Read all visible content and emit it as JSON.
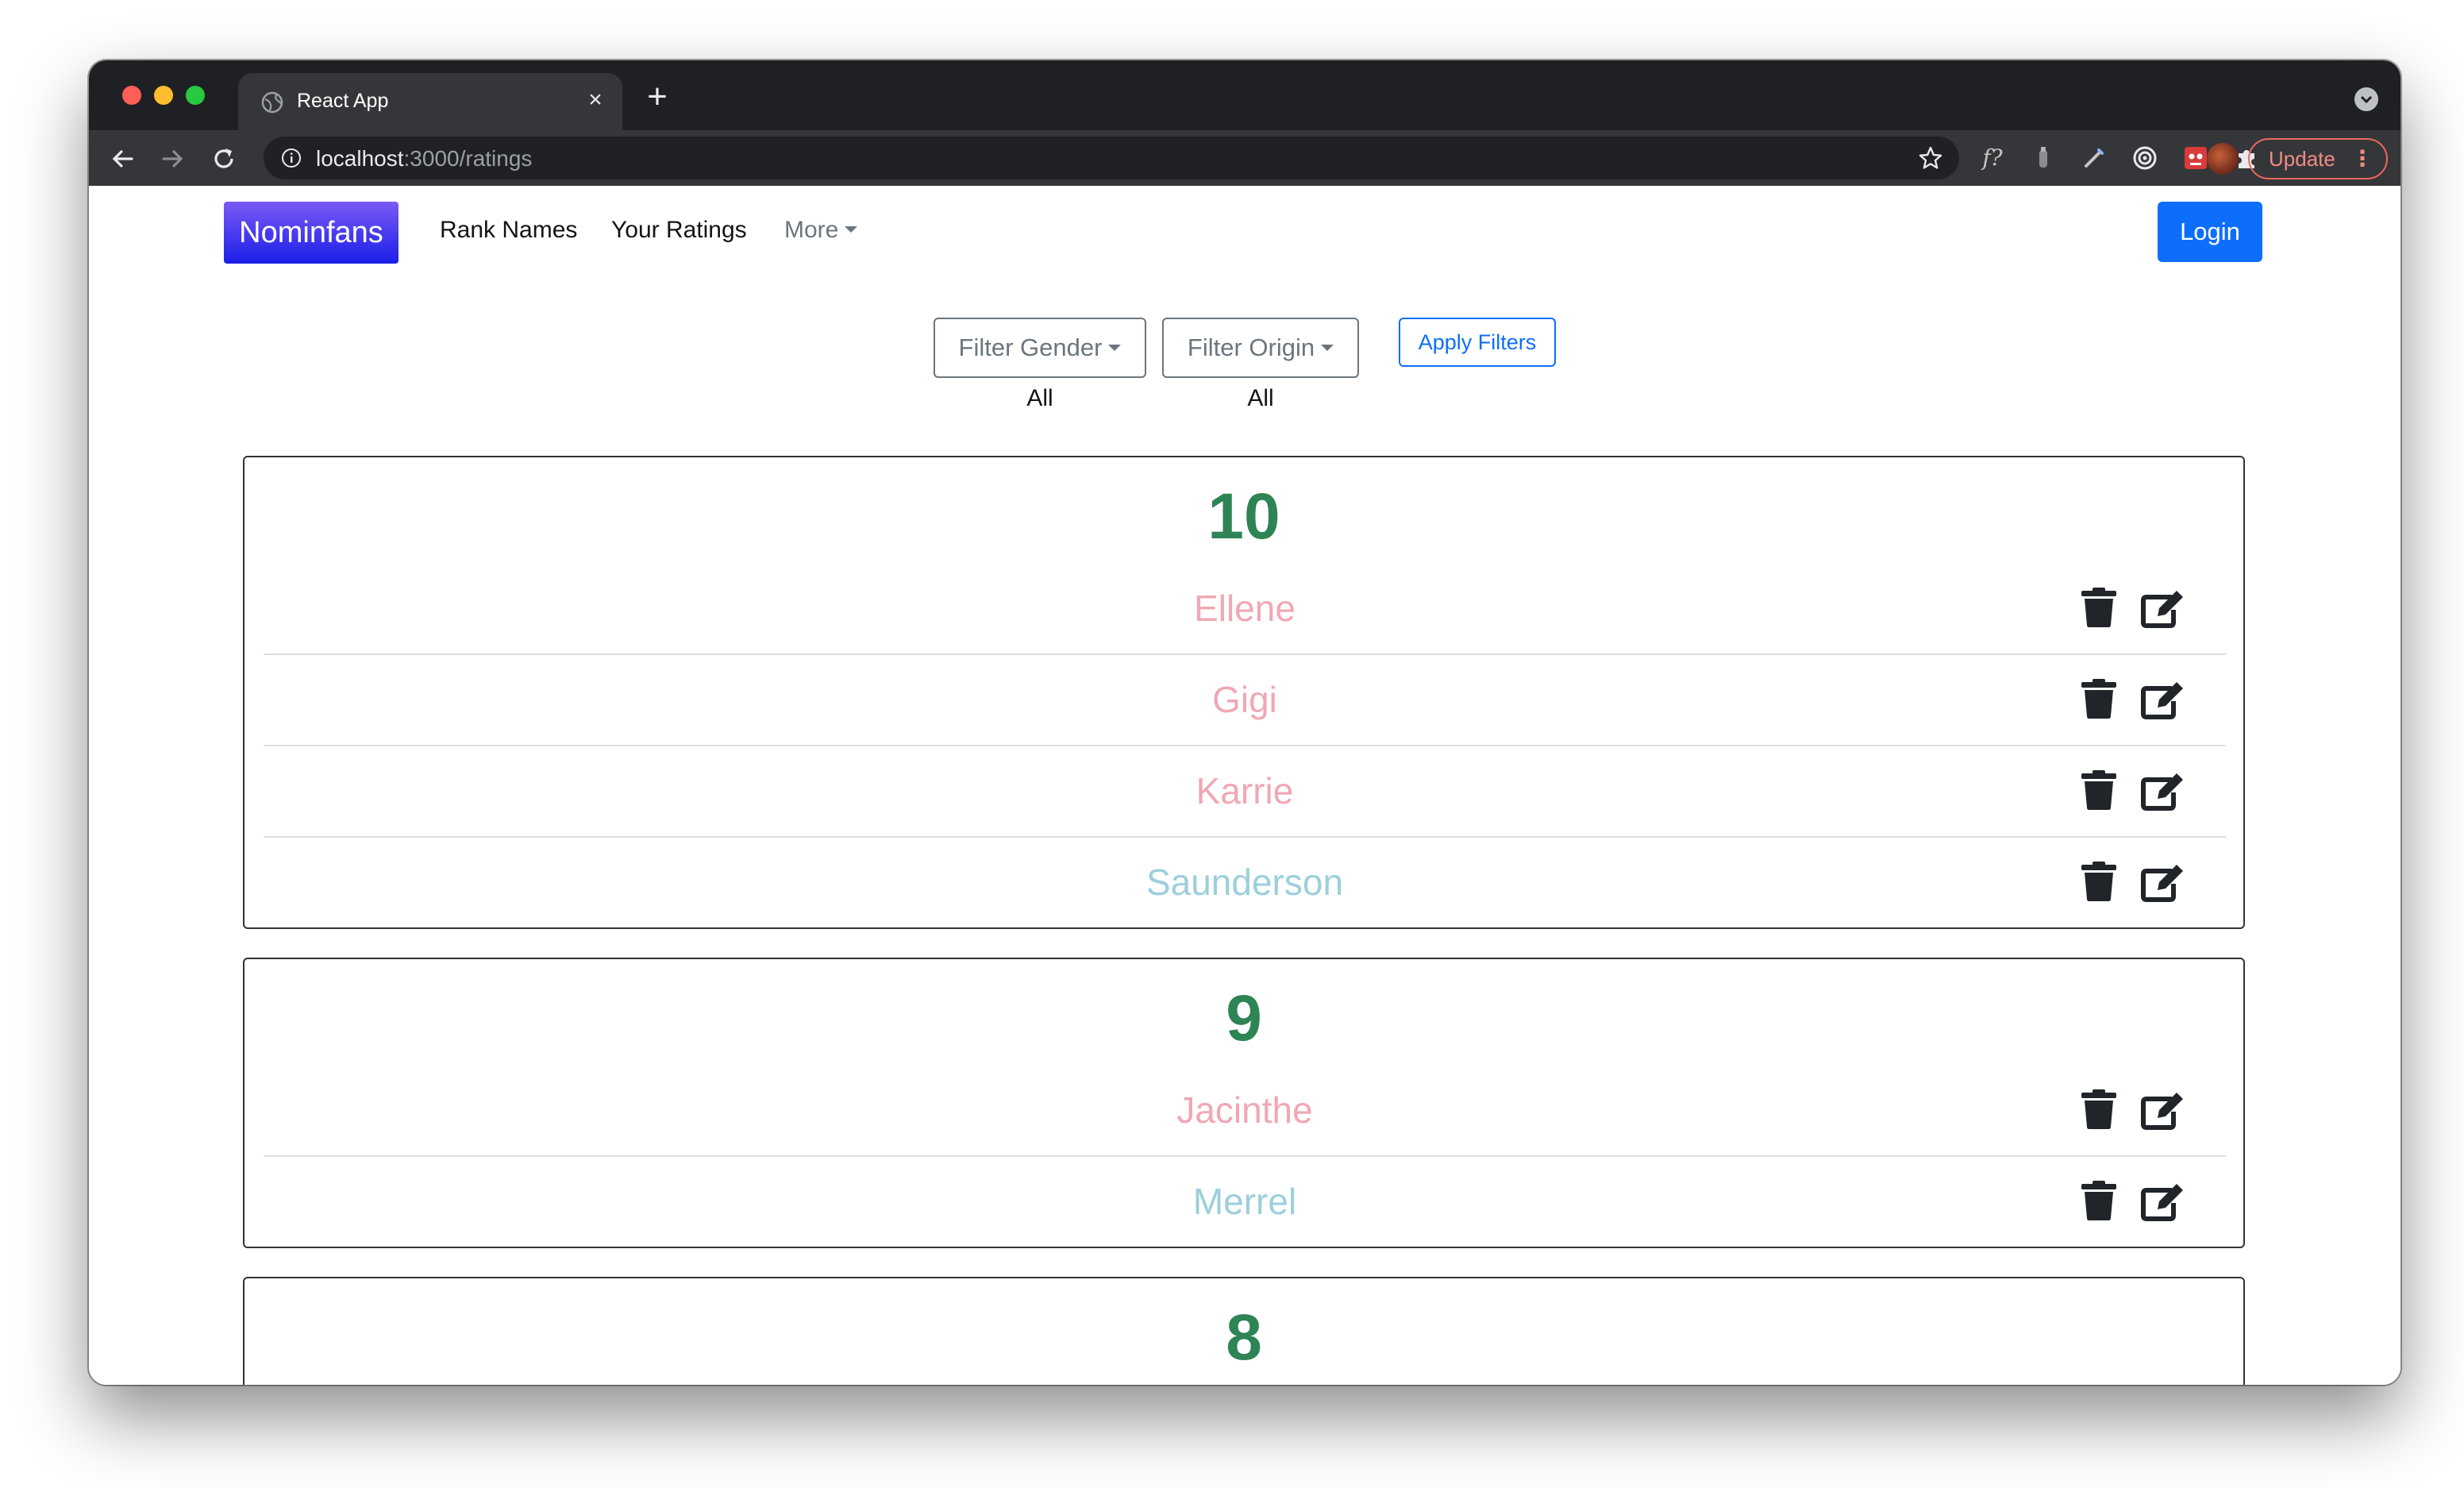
{
  "browser": {
    "tab_title": "React App",
    "url_host": "localhost",
    "url_path": ":3000/ratings",
    "update_label": "Update",
    "extension_icons": [
      "function-icon",
      "bottle-icon",
      "wand-icon",
      "target-icon",
      "robot-icon",
      "puzzle-icon",
      "avatar"
    ]
  },
  "navbar": {
    "brand": "Nominfans",
    "links": [
      "Rank Names",
      "Your Ratings"
    ],
    "more_label": "More",
    "login_label": "Login"
  },
  "filters": {
    "gender_label": "Filter Gender",
    "gender_value": "All",
    "origin_label": "Filter Origin",
    "origin_value": "All",
    "apply_label": "Apply Filters"
  },
  "colors": {
    "score": "#2e8454",
    "girl_name": "#f0a8b4",
    "boy_name": "#9ccfdb",
    "primary": "#0d6efd"
  },
  "ratings": [
    {
      "score": "10",
      "names": [
        {
          "name": "Ellene",
          "gender": "girl"
        },
        {
          "name": "Gigi",
          "gender": "girl"
        },
        {
          "name": "Karrie",
          "gender": "girl"
        },
        {
          "name": "Saunderson",
          "gender": "boy"
        }
      ]
    },
    {
      "score": "9",
      "names": [
        {
          "name": "Jacinthe",
          "gender": "girl"
        },
        {
          "name": "Merrel",
          "gender": "boy"
        }
      ]
    },
    {
      "score": "8",
      "names": []
    }
  ]
}
